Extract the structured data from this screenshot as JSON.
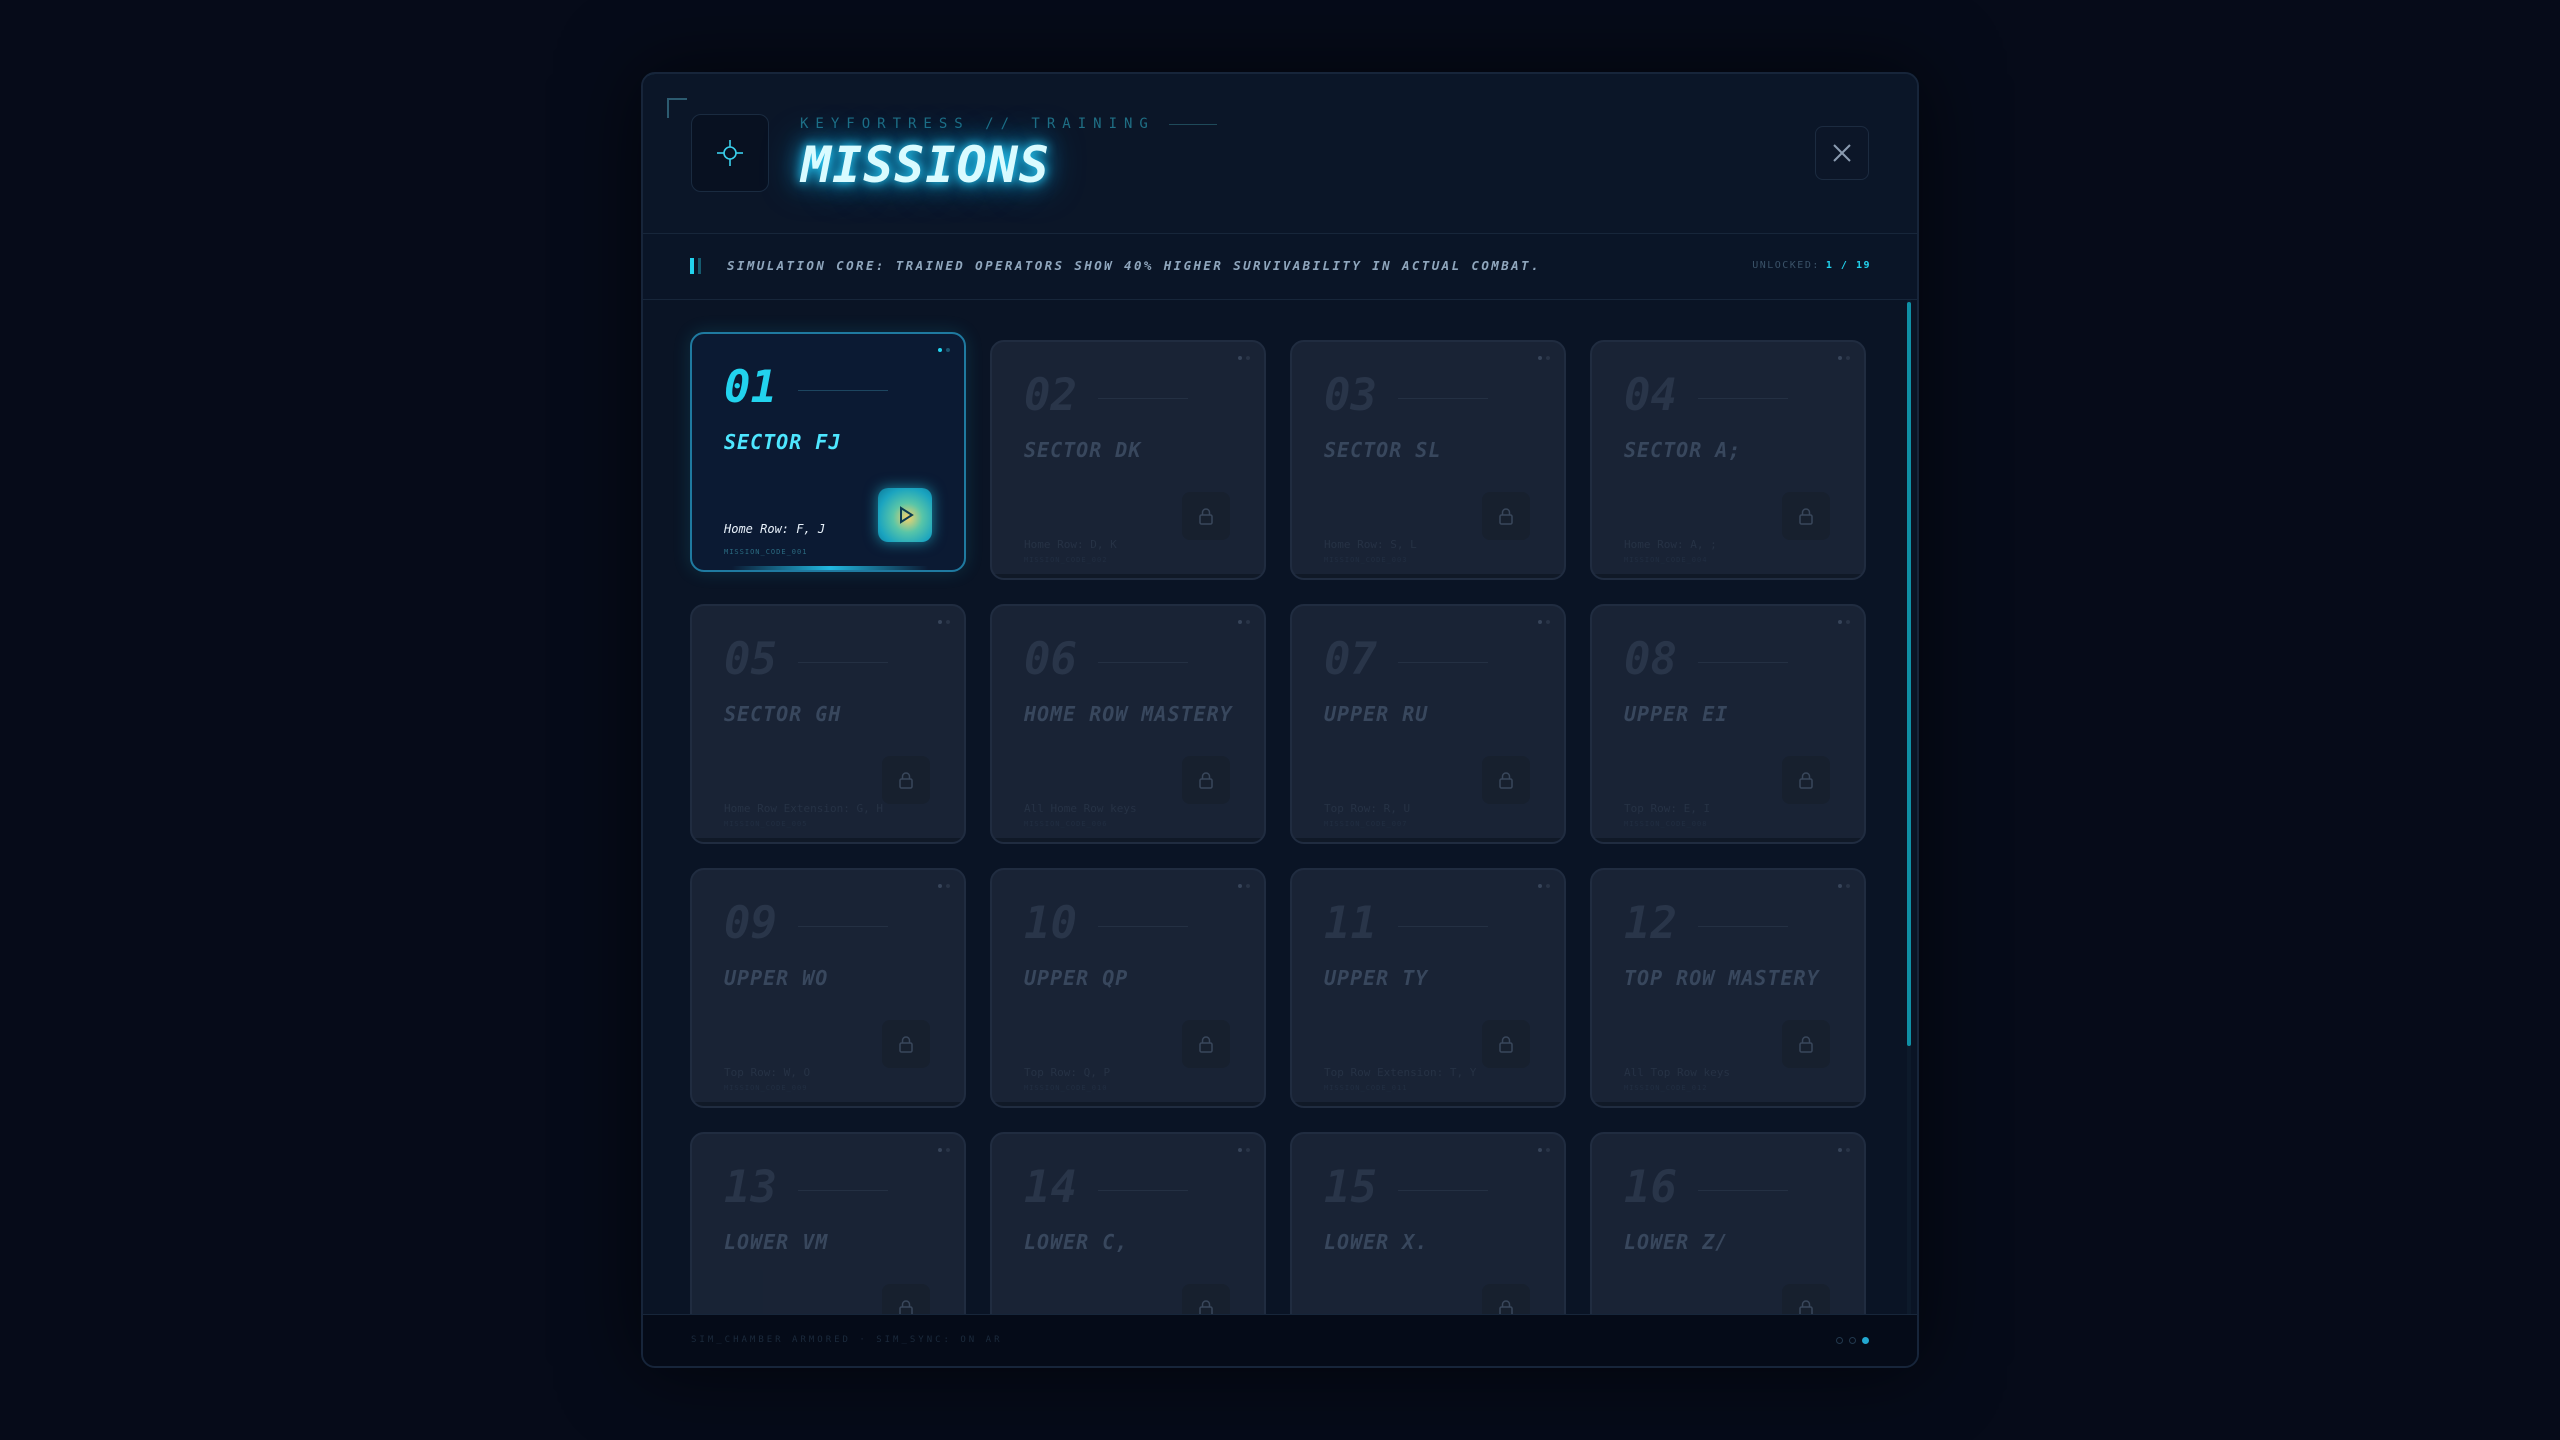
{
  "header": {
    "subtitle": "KEYFORTRESS // TRAINING",
    "title": "MISSIONS",
    "close_label": "Close"
  },
  "banner": {
    "text": "SIMULATION CORE: TRAINED OPERATORS SHOW 40% HIGHER SURVIVABILITY IN ACTUAL COMBAT.",
    "unlocked_label": "UNLOCKED:",
    "unlocked_value": "1 / 19"
  },
  "missions": [
    {
      "num": "01",
      "name": "SECTOR FJ",
      "desc": "Home Row: F, J",
      "code": "MISSION_CODE_001",
      "status": "unlocked"
    },
    {
      "num": "02",
      "name": "SECTOR DK",
      "desc": "Home Row: D, K",
      "code": "MISSION_CODE_002",
      "status": "locked"
    },
    {
      "num": "03",
      "name": "SECTOR SL",
      "desc": "Home Row: S, L",
      "code": "MISSION_CODE_003",
      "status": "locked"
    },
    {
      "num": "04",
      "name": "SECTOR A;",
      "desc": "Home Row: A, ;",
      "code": "MISSION_CODE_004",
      "status": "locked"
    },
    {
      "num": "05",
      "name": "SECTOR GH",
      "desc": "Home Row Extension: G, H",
      "code": "MISSION_CODE_005",
      "status": "locked"
    },
    {
      "num": "06",
      "name": "HOME ROW MASTERY",
      "desc": "All Home Row keys",
      "code": "MISSION_CODE_006",
      "status": "locked"
    },
    {
      "num": "07",
      "name": "UPPER RU",
      "desc": "Top Row: R, U",
      "code": "MISSION_CODE_007",
      "status": "locked"
    },
    {
      "num": "08",
      "name": "UPPER EI",
      "desc": "Top Row: E, I",
      "code": "MISSION_CODE_008",
      "status": "locked"
    },
    {
      "num": "09",
      "name": "UPPER WO",
      "desc": "Top Row: W, O",
      "code": "MISSION_CODE_009",
      "status": "locked"
    },
    {
      "num": "10",
      "name": "UPPER QP",
      "desc": "Top Row: Q, P",
      "code": "MISSION_CODE_010",
      "status": "locked"
    },
    {
      "num": "11",
      "name": "UPPER TY",
      "desc": "Top Row Extension: T, Y",
      "code": "MISSION_CODE_011",
      "status": "locked"
    },
    {
      "num": "12",
      "name": "TOP ROW MASTERY",
      "desc": "All Top Row keys",
      "code": "MISSION_CODE_012",
      "status": "locked"
    },
    {
      "num": "13",
      "name": "LOWER VM",
      "desc": "",
      "code": "",
      "status": "locked"
    },
    {
      "num": "14",
      "name": "LOWER C,",
      "desc": "",
      "code": "",
      "status": "locked"
    },
    {
      "num": "15",
      "name": "LOWER X.",
      "desc": "",
      "code": "",
      "status": "locked"
    },
    {
      "num": "16",
      "name": "LOWER Z/",
      "desc": "",
      "code": "",
      "status": "locked"
    }
  ],
  "footer": {
    "text": "SIM_CHAMBER ARMORED  ·  SIM_SYNC: ON AR"
  },
  "colors": {
    "accent": "#22d3ee",
    "background": "#060b19",
    "panel": "#0a1425",
    "card_locked": "#1a2436",
    "card_active": "#0b1a33"
  },
  "icons": {
    "header": "crosshair-icon",
    "close": "close-icon",
    "locked": "lock-icon",
    "play": "play-icon"
  }
}
